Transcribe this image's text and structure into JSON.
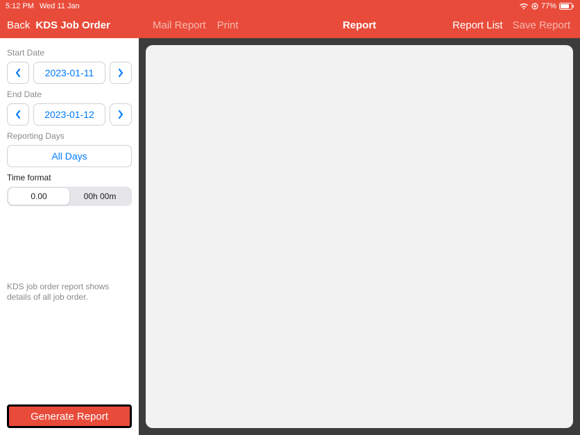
{
  "statusbar": {
    "time": "5:12 PM",
    "date": "Wed 11 Jan",
    "battery": "77%"
  },
  "header": {
    "back": "Back",
    "title": "KDS Job Order",
    "mail_report": "Mail Report",
    "print": "Print",
    "center": "Report",
    "report_list": "Report List",
    "save_report": "Save Report"
  },
  "sidebar": {
    "start_date_label": "Start Date",
    "start_date": "2023-01-11",
    "end_date_label": "End Date",
    "end_date": "2023-01-12",
    "reporting_days_label": "Reporting Days",
    "reporting_days_value": "All Days",
    "time_format_label": "Time format",
    "time_format_options": {
      "decimal": "0.00",
      "hms": "00h 00m"
    },
    "description": "KDS job order report shows details of all job order.",
    "generate": "Generate Report"
  }
}
